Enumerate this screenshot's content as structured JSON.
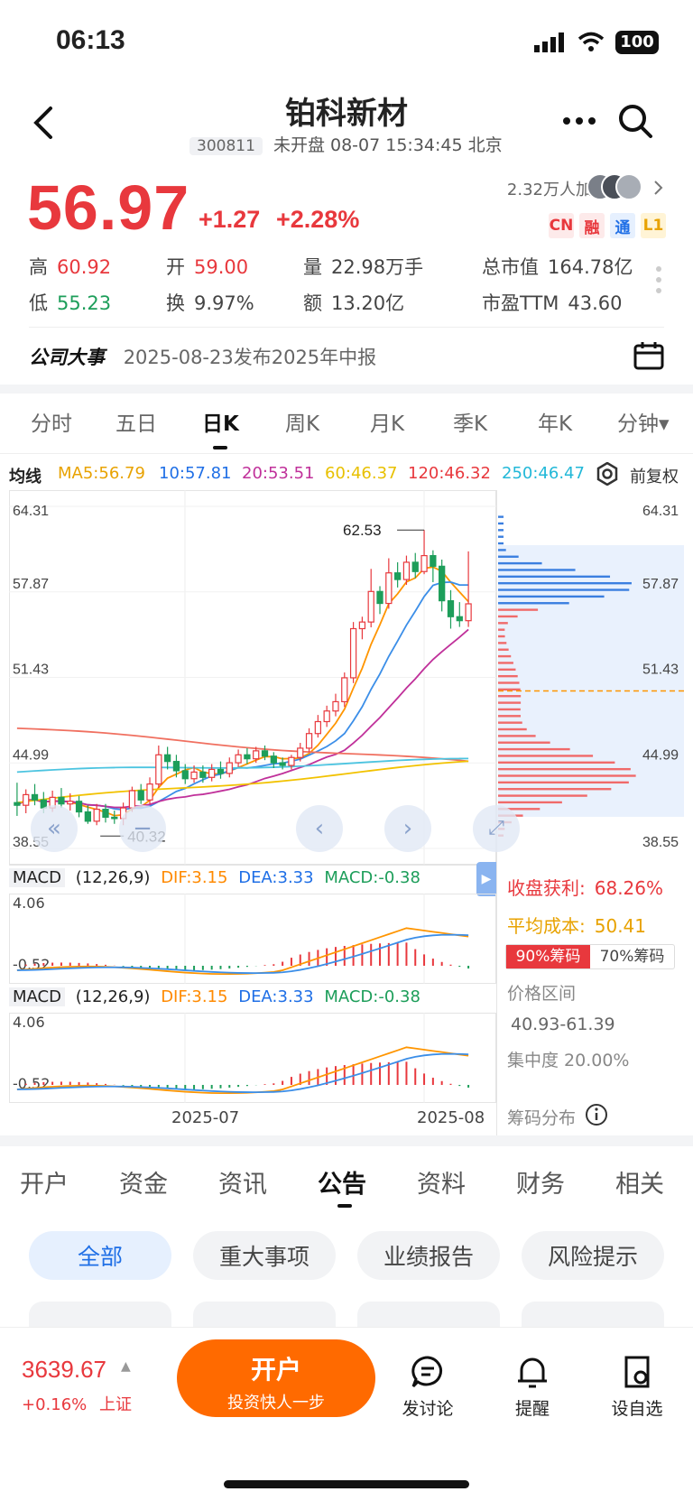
{
  "status_bar": {
    "time": "06:13",
    "battery": "100"
  },
  "header": {
    "title": "铂科新材",
    "code": "300811",
    "status": "未开盘 08-07 15:34:45 北京"
  },
  "quote": {
    "price": "56.97",
    "change": "+1.27",
    "change_pct": "+2.28%",
    "followers": "2.32万人加自选",
    "badges": [
      "CN",
      "融",
      "通",
      "L1"
    ],
    "stats": {
      "high_label": "高",
      "high": "60.92",
      "open_label": "开",
      "open": "59.00",
      "volume_label": "量",
      "volume": "22.98万手",
      "mktcap_label": "总市值",
      "mktcap": "164.78亿",
      "low_label": "低",
      "low": "55.23",
      "turnover_label": "换",
      "turnover": "9.97%",
      "amount_label": "额",
      "amount": "13.20亿",
      "pe_label": "市盈TTM",
      "pe": "43.60"
    }
  },
  "event": {
    "label": "公司大事",
    "text": "2025-08-23发布2025年中报"
  },
  "period_tabs": [
    "分时",
    "五日",
    "日K",
    "周K",
    "月K",
    "季K",
    "年K",
    "分钟▾"
  ],
  "active_period": "日K",
  "ma_row": {
    "label": "均线",
    "ma5": "MA5:56.79",
    "ma10": "10:57.81",
    "ma20": "20:53.51",
    "ma60": "60:46.37",
    "ma120": "120:46.32",
    "ma250": "250:46.47",
    "adjust": "前复权"
  },
  "chart_data": {
    "type": "candlestick",
    "y_ticks": [
      "64.31",
      "57.87",
      "51.43",
      "44.99",
      "38.55"
    ],
    "ylim": [
      38.55,
      64.31
    ],
    "x_ticks": [
      "2025-07",
      "2025-08"
    ],
    "high_marker": "62.53",
    "low_marker": "40.32",
    "candles": [
      [
        42.0,
        41.8,
        43.5,
        41.0
      ],
      [
        41.8,
        42.6,
        43.0,
        41.2
      ],
      [
        42.6,
        42.2,
        43.4,
        41.8
      ],
      [
        42.2,
        41.6,
        42.8,
        41.2
      ],
      [
        41.6,
        42.4,
        42.9,
        41.3
      ],
      [
        42.4,
        41.9,
        43.1,
        41.6
      ],
      [
        41.9,
        42.1,
        42.7,
        41.4
      ],
      [
        42.1,
        41.3,
        42.5,
        40.9
      ],
      [
        41.3,
        40.6,
        41.8,
        40.4
      ],
      [
        40.6,
        41.5,
        41.9,
        40.3
      ],
      [
        41.5,
        40.9,
        41.9,
        40.5
      ],
      [
        40.9,
        40.8,
        41.4,
        40.4
      ],
      [
        40.8,
        41.6,
        42.0,
        40.3
      ],
      [
        41.6,
        42.9,
        43.2,
        41.3
      ],
      [
        42.9,
        42.2,
        43.4,
        41.9
      ],
      [
        42.2,
        43.4,
        43.9,
        41.9
      ],
      [
        43.4,
        45.6,
        46.3,
        43.1
      ],
      [
        45.6,
        45.1,
        46.2,
        44.5
      ],
      [
        45.1,
        44.4,
        45.6,
        43.9
      ],
      [
        44.4,
        43.8,
        44.9,
        43.4
      ],
      [
        43.8,
        44.3,
        44.8,
        43.5
      ],
      [
        44.3,
        43.9,
        44.8,
        43.5
      ],
      [
        43.9,
        44.5,
        44.9,
        43.6
      ],
      [
        44.5,
        44.2,
        45.1,
        43.8
      ],
      [
        44.2,
        45.0,
        45.4,
        43.9
      ],
      [
        45.0,
        45.6,
        46.0,
        44.7
      ],
      [
        45.6,
        45.3,
        46.1,
        44.9
      ],
      [
        45.3,
        45.9,
        46.2,
        45.0
      ],
      [
        45.9,
        45.5,
        46.3,
        45.2
      ],
      [
        45.5,
        45.0,
        45.8,
        44.6
      ],
      [
        45.0,
        44.8,
        45.4,
        44.5
      ],
      [
        44.8,
        45.4,
        45.6,
        44.5
      ],
      [
        45.4,
        46.1,
        46.5,
        45.1
      ],
      [
        46.1,
        47.2,
        47.6,
        45.8
      ],
      [
        47.2,
        48.1,
        48.6,
        46.9
      ],
      [
        48.1,
        48.9,
        49.3,
        47.7
      ],
      [
        48.9,
        49.6,
        50.2,
        48.5
      ],
      [
        49.6,
        51.4,
        51.8,
        49.2
      ],
      [
        51.4,
        55.1,
        55.6,
        51.0
      ],
      [
        55.1,
        55.6,
        56.0,
        54.3
      ],
      [
        55.6,
        57.9,
        59.6,
        55.2
      ],
      [
        57.9,
        57.0,
        58.3,
        56.2
      ],
      [
        57.0,
        59.3,
        60.4,
        56.6
      ],
      [
        59.3,
        58.8,
        60.1,
        58.2
      ],
      [
        58.8,
        60.1,
        60.6,
        58.4
      ],
      [
        60.1,
        59.4,
        60.8,
        58.9
      ],
      [
        59.4,
        60.6,
        62.53,
        59.2
      ],
      [
        60.6,
        59.8,
        61.0,
        58.6
      ],
      [
        59.8,
        57.2,
        60.3,
        56.4
      ],
      [
        57.2,
        56.0,
        58.0,
        55.1
      ],
      [
        56.0,
        55.7,
        57.1,
        55.23
      ],
      [
        55.7,
        56.97,
        60.92,
        55.23
      ]
    ],
    "macd": {
      "label": "MACD",
      "params": "(12,26,9)",
      "dif": "DIF:3.15",
      "dea": "DEA:3.33",
      "macd": "MACD:-0.38",
      "y_top": "4.06",
      "y_bottom": "-0.52"
    }
  },
  "chips": {
    "profit_label": "收盘获利:",
    "profit": "68.26%",
    "cost_label": "平均成本:",
    "cost": "50.41",
    "tab_90": "90%筹码",
    "tab_70": "70%筹码",
    "range_label": "价格区间",
    "range": "40.93-61.39",
    "concentration": "集中度 20.00%",
    "dist_label": "筹码分布"
  },
  "section_tabs": [
    "开户",
    "资金",
    "资讯",
    "公告",
    "资料",
    "财务",
    "相关"
  ],
  "active_section": "公告",
  "filter_pills": [
    "全部",
    "重大事项",
    "业绩报告",
    "风险提示"
  ],
  "footer": {
    "index_value": "3639.67",
    "index_change": "+0.16%",
    "index_name": "上证",
    "open_title": "开户",
    "open_sub": "投资快人一步",
    "discuss": "发讨论",
    "remind": "提醒",
    "watch": "设自选"
  },
  "colors": {
    "red": "#e8383d",
    "green": "#1d9e5a",
    "orange": "#ff6a00",
    "blue": "#1f6fe6"
  }
}
